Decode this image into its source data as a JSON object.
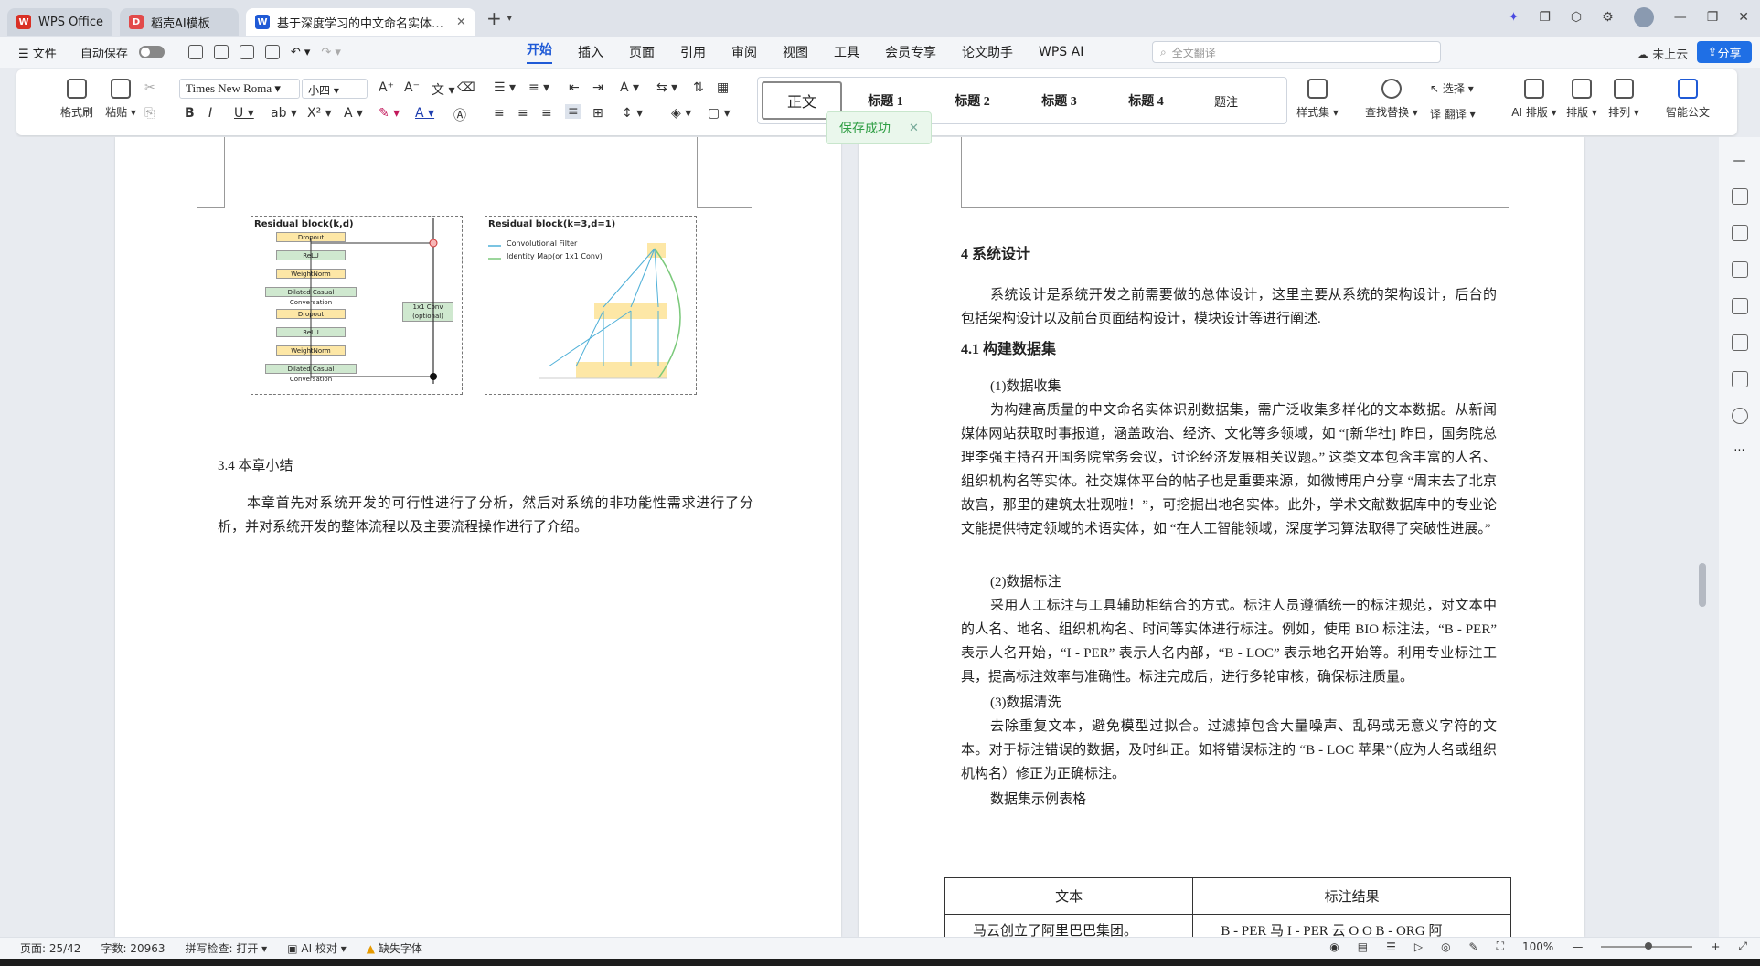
{
  "tabs": [
    {
      "label": "WPS Office",
      "color": "#d93025",
      "logo": "W"
    },
    {
      "label": "稻壳AI模板",
      "color": "#e24a4a",
      "logo": "D"
    },
    {
      "label": "基于深度学习的中文命名实体…",
      "color": "#1f5ad6",
      "logo": "W"
    }
  ],
  "menubar": {
    "file": "文件",
    "autosave": "自动保存",
    "menus": [
      "开始",
      "插入",
      "页面",
      "引用",
      "审阅",
      "视图",
      "工具",
      "会员专享",
      "论文助手",
      "WPS AI"
    ],
    "search_placeholder": "全文翻译",
    "cloud": "未上云",
    "share": "分享"
  },
  "ribbon": {
    "format_painter": "格式刷",
    "paste": "粘贴",
    "font": "Times New Roma",
    "size": "小四",
    "styles": [
      "正文",
      "标题 1",
      "标题 2",
      "标题 3",
      "标题 4",
      "题注"
    ],
    "style_set": "样式集",
    "find_replace": "查找替换",
    "select": "选择",
    "translate": "翻译",
    "ai_layout": "AI 排版",
    "layout": "排版",
    "arrange": "排列",
    "smart_doc": "智能公文"
  },
  "toast": {
    "text": "保存成功"
  },
  "left_page": {
    "figure": {
      "left_title": "Residual block(k,d)",
      "right_title": "Residual block(k=3,d=1)",
      "blocks": [
        "Dropout",
        "ReLU",
        "WeightNorm",
        "Dilated Casual Conversation",
        "Dropout",
        "ReLU",
        "WeightNorm",
        "Dilated Casual Conversation"
      ],
      "conv": "1x1 Conv (optional)",
      "legend1": "Convolutional Filter",
      "legend2": "Identity Map(or 1x1 Conv)"
    },
    "section_title": "3.4 本章小结",
    "summary": "本章首先对系统开发的可行性进行了分析，然后对系统的非功能性需求进行了分析，并对系统开发的整体流程以及主要流程操作进行了介绍。"
  },
  "right_page": {
    "h4": "4  系统设计",
    "p1": "系统设计是系统开发之前需要做的总体设计，这里主要从系统的架构设计，后台的包括架构设计以及前台页面结构设计，模块设计等进行阐述.",
    "h41": "4.1  构建数据集",
    "s1": "(1)数据收集",
    "p2": "为构建高质量的中文命名实体识别数据集，需广泛收集多样化的文本数据。从新闻媒体网站获取时事报道，涵盖政治、经济、文化等多领域，如 “[新华社] 昨日，国务院总理李强主持召开国务院常务会议，讨论经济发展相关议题。” 这类文本包含丰富的人名、组织机构名等实体。社交媒体平台的帖子也是重要来源，如微博用户分享 “周末去了北京故宫，那里的建筑太壮观啦！”，可挖掘出地名实体。此外，学术文献数据库中的专业论文能提供特定领域的术语实体，如 “在人工智能领域，深度学习算法取得了突破性进展。”",
    "s2": "(2)数据标注",
    "p3": "采用人工标注与工具辅助相结合的方式。标注人员遵循统一的标注规范，对文本中的人名、地名、组织机构名、时间等实体进行标注。例如，使用 BIO 标注法，“B - PER” 表示人名开始，“I - PER” 表示人名内部，“B - LOC” 表示地名开始等。利用专业标注工具，提高标注效率与准确性。标注完成后，进行多轮审核，确保标注质量。",
    "s3": "(3)数据清洗",
    "p4": "去除重复文本，避免模型过拟合。过滤掉包含大量噪声、乱码或无意义字符的文本。对于标注错误的数据，及时纠正。如将错误标注的 “B - LOC 苹果”（应为人名或组织机构名）修正为正确标注。",
    "table_caption": "数据集示例表格",
    "table": {
      "headers": [
        "文本",
        "标注结果"
      ],
      "row1": [
        "马云创立了阿里巴巴集团。",
        "B - PER 马 I - PER 云 O O B - ORG 阿"
      ]
    }
  },
  "statusbar": {
    "page": "页面: 25/42",
    "words": "字数: 20963",
    "spell": "拼写检查: 打开",
    "ai_check": "AI 校对",
    "missing_font": "缺失字体",
    "zoom": "100%"
  }
}
